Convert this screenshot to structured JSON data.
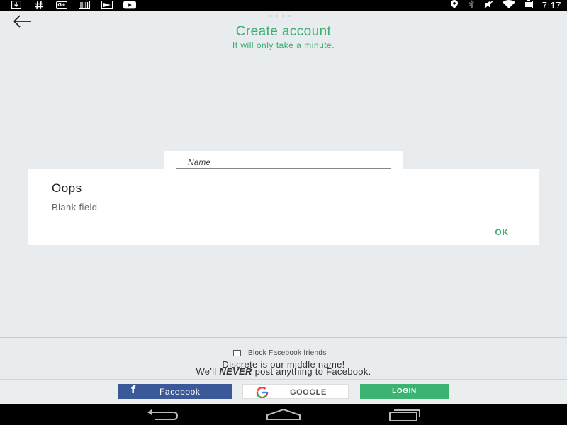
{
  "status_bar": {
    "time": "7:17",
    "left_icons": [
      "download-icon",
      "hashtag-icon",
      "google-plus-icon",
      "barcode-icon",
      "send-icon",
      "youtube-icon"
    ],
    "right_icons": [
      "location-icon",
      "bluetooth-icon",
      "mute-icon",
      "wifi-icon",
      "battery-icon"
    ]
  },
  "header": {
    "back_icon": "back-arrow-icon",
    "title": "Create account",
    "subtitle": "It will only take a minute."
  },
  "form": {
    "name_placeholder": "Name"
  },
  "dialog": {
    "title": "Oops",
    "message": "Blank field",
    "ok_label": "OK"
  },
  "footer": {
    "block_label": "Block Facebook friends",
    "disclaimer_line1": "Discrete is our middle name!",
    "disclaimer_line2_pre": "We'll",
    "disclaimer_line2_em": "NEVER",
    "disclaimer_line2_post": "post anything to Facebook.",
    "facebook_label": "Facebook",
    "google_label": "GOOGLE",
    "login_label": "LOGIN"
  },
  "colors": {
    "accent": "#3cae72",
    "facebook": "#3b5998",
    "login": "#3cb371",
    "background": "#e8ecef"
  },
  "nav_bar": {
    "icons": [
      "nav-back-icon",
      "nav-home-icon",
      "nav-recents-icon"
    ]
  }
}
